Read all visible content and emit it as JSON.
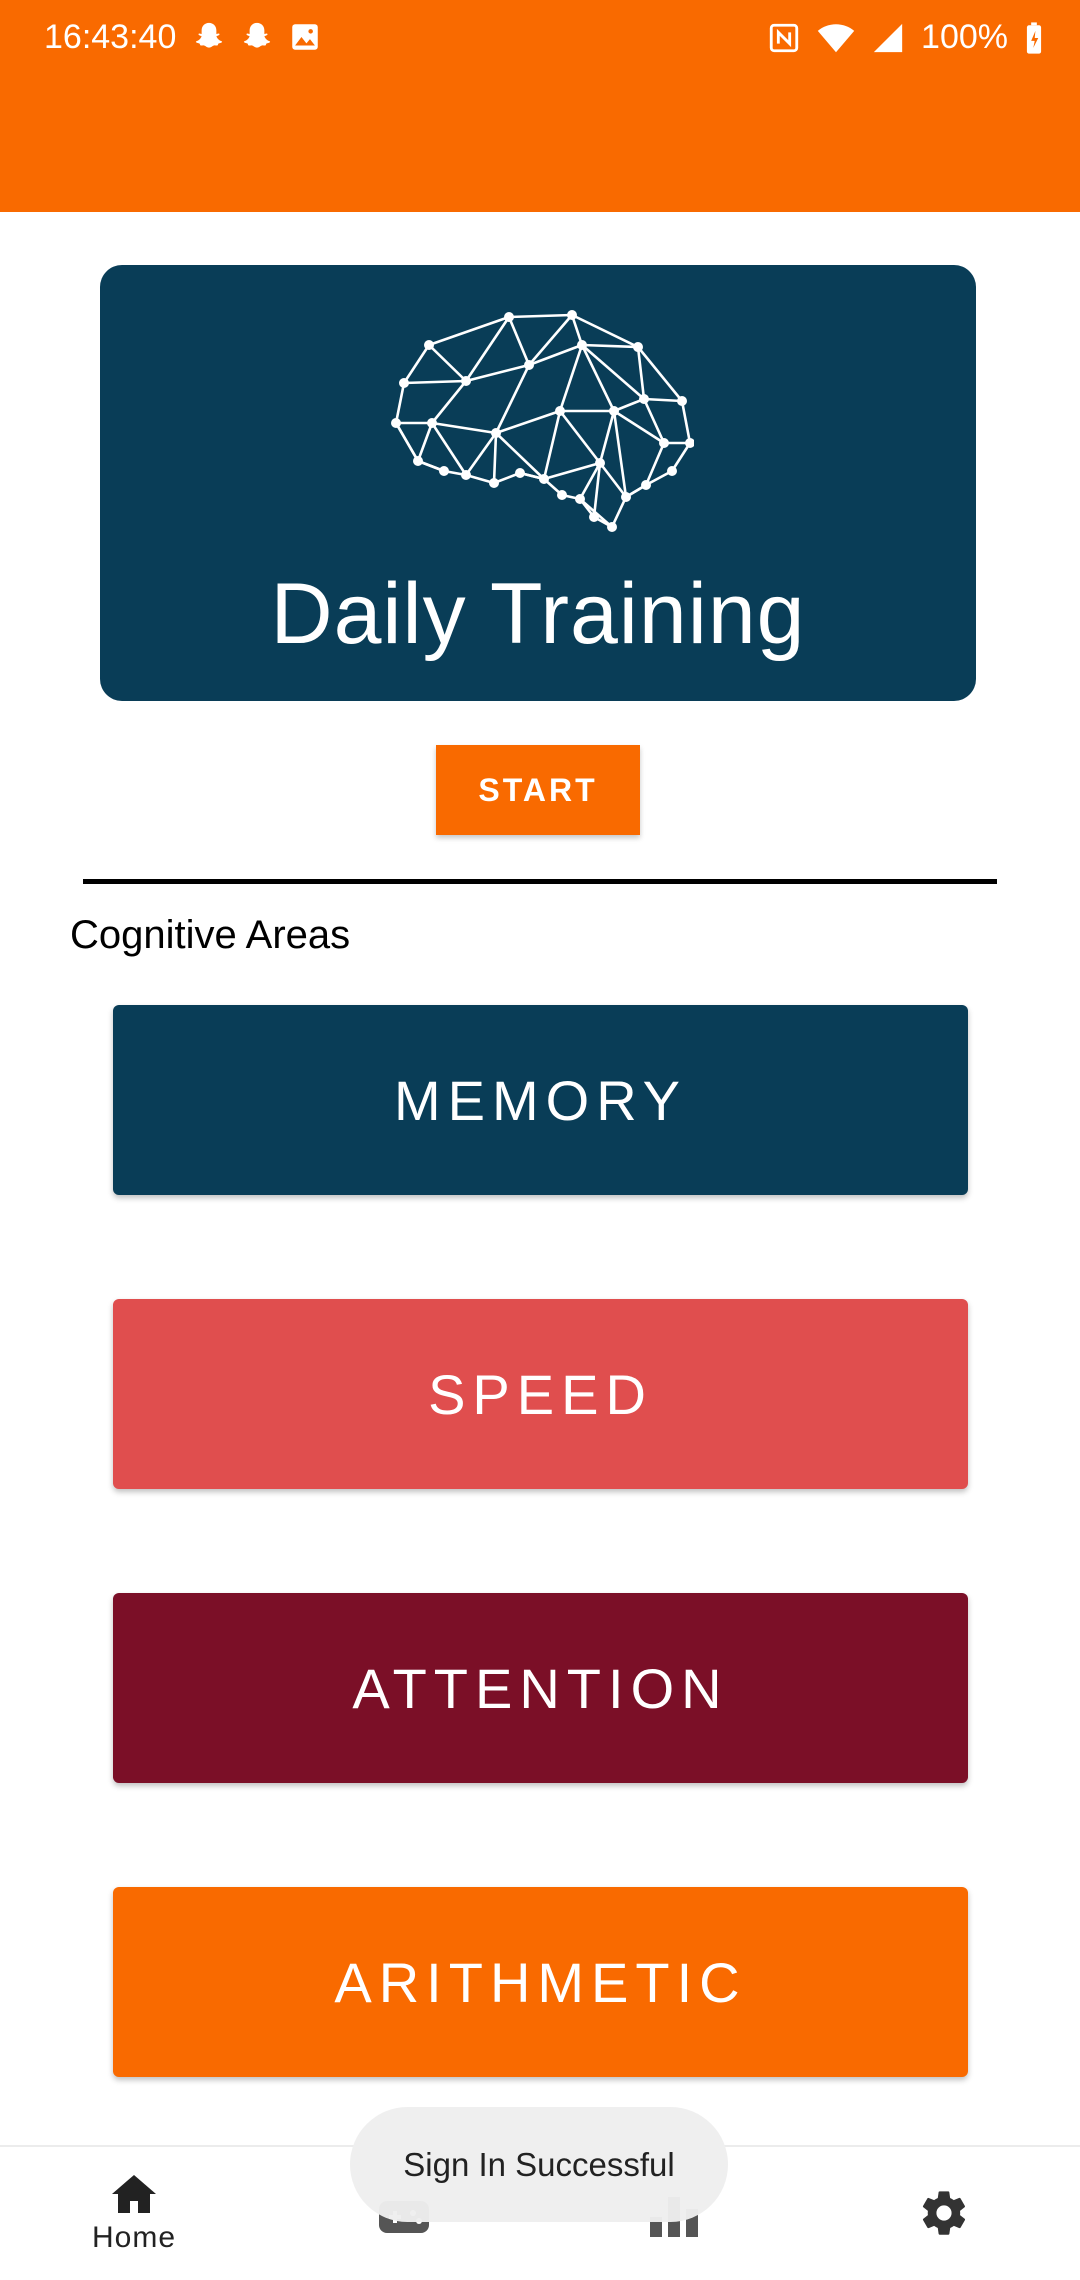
{
  "status_bar": {
    "time": "16:43:40",
    "battery": "100%",
    "left_icons": [
      "snapchat-icon",
      "snapchat-icon",
      "image-icon"
    ],
    "right_icons": [
      "nfc-icon",
      "wifi-icon",
      "signal-icon",
      "battery-charging-icon"
    ]
  },
  "hero": {
    "title": "Daily Training",
    "icon": "brain-network-icon"
  },
  "start_button": {
    "label": "START"
  },
  "section": {
    "title": "Cognitive Areas"
  },
  "areas": [
    {
      "label": "MEMORY",
      "color": "#093d57"
    },
    {
      "label": "SPEED",
      "color": "#e04e4e"
    },
    {
      "label": "ATTENTION",
      "color": "#7b0f27"
    },
    {
      "label": "ARITHMETIC",
      "color": "#f96a00"
    }
  ],
  "bottom_nav": {
    "items": [
      {
        "label": "Home",
        "icon": "home-icon",
        "selected": true
      },
      {
        "label": "",
        "icon": "gamepad-icon"
      },
      {
        "label": "",
        "icon": "bar-chart-icon"
      },
      {
        "label": "",
        "icon": "gear-icon"
      }
    ]
  },
  "toast": {
    "message": "Sign In Successful"
  },
  "colors": {
    "accent": "#f96a00",
    "navy": "#093d57",
    "speed": "#e04e4e",
    "attention": "#7b0f27"
  }
}
